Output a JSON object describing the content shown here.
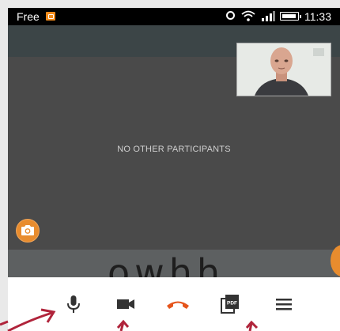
{
  "status_bar": {
    "carrier": "Free",
    "time": "11:33",
    "icons": [
      "notification-icon",
      "alarm-icon",
      "wifi-icon",
      "signal-icon",
      "battery-icon"
    ]
  },
  "call": {
    "message": "NO OTHER PARTICIPANTS",
    "background_logo": "owhh"
  },
  "toolbar": {
    "buttons": [
      "microphone-icon",
      "video-camera-icon",
      "hang-up-icon",
      "pdf-icon",
      "menu-icon"
    ]
  },
  "colors": {
    "accent": "#e88c2e",
    "hangup": "#e5541b",
    "annotation": "#b0243b",
    "video_bg": "#4a4a4a"
  }
}
